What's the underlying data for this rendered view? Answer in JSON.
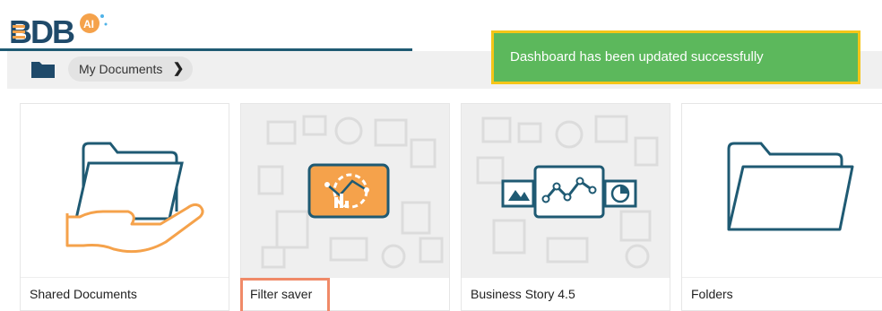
{
  "app": {
    "logo_text": "BDB",
    "logo_badge": "AI",
    "accent": "#1f5a73",
    "highlight": "#f5a24b"
  },
  "breadcrumb": {
    "icon": "folder-icon",
    "current": "My Documents",
    "chevron": "❯"
  },
  "toast": {
    "message": "Dashboard has been updated successfully",
    "color": "#5cb85c",
    "border_color": "#f5c518"
  },
  "cards": [
    {
      "title": "Shared Documents",
      "icon": "shared-folder-hand-icon"
    },
    {
      "title": "Filter saver",
      "icon": "analytics-dashboard-icon"
    },
    {
      "title": "Business Story 4.5",
      "icon": "business-story-icon"
    },
    {
      "title": "Folders",
      "icon": "folder-outline-icon"
    }
  ]
}
